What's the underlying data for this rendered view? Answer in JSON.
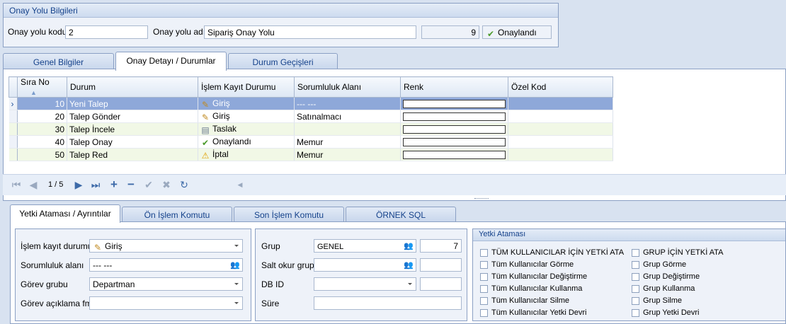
{
  "header": {
    "title": "Onay Yolu Bilgileri",
    "code_label": "Onay yolu kodu",
    "code_value": "2",
    "name_label": "Onay yolu adı",
    "name_value": "Sipariş Onay Yolu",
    "count_value": "9",
    "status_label": "Onaylandı"
  },
  "tabs": [
    "Genel Bilgiler",
    "Onay Detayı / Durumlar",
    "Durum Geçişleri"
  ],
  "grid": {
    "columns": [
      "Sıra No",
      "Durum",
      "İşlem Kayıt Durumu",
      "Sorumluluk Alanı",
      "Renk",
      "Özel Kod"
    ],
    "rows": [
      {
        "no": "10",
        "durum": "Yeni Talep",
        "islem": "Giriş",
        "islem_icon": "edit-icon",
        "sorumluluk": "--- ---"
      },
      {
        "no": "20",
        "durum": "Talep Gönder",
        "islem": "Giriş",
        "islem_icon": "edit-icon",
        "sorumluluk": "Satınalmacı"
      },
      {
        "no": "30",
        "durum": "Talep İncele",
        "islem": "Taslak",
        "islem_icon": "document-icon",
        "sorumluluk": ""
      },
      {
        "no": "40",
        "durum": "Talep Onay",
        "islem": "Onaylandı",
        "islem_icon": "check-icon",
        "sorumluluk": "Memur"
      },
      {
        "no": "50",
        "durum": "Talep Red",
        "islem": "İptal",
        "islem_icon": "warning-icon",
        "sorumluluk": "Memur"
      }
    ]
  },
  "navigator": {
    "position": "1 / 5"
  },
  "subtabs": [
    "Yetki Ataması / Ayrıntılar",
    "Ön İşlem Komutu",
    "Son İşlem Komutu",
    "ÖRNEK SQL"
  ],
  "details": {
    "islem_kayit_label": "İşlem kayıt durumu",
    "islem_kayit_value": "Giriş",
    "sorumluluk_label": "Sorumluluk alanı",
    "sorumluluk_value": "--- ---",
    "gorev_label": "Görev grubu",
    "gorev_value": "Departman",
    "gorev_fmt_label": "Görev açıklama fmt",
    "gorev_fmt_value": "",
    "grup_label": "Grup",
    "grup_value": "GENEL",
    "grup_num": "7",
    "salt_label": "Salt okur grup",
    "dbid_label": "DB ID",
    "sure_label": "Süre"
  },
  "yetki": {
    "title": "Yetki Ataması",
    "left": [
      "TÜM KULLANICILAR İÇİN YETKİ ATA",
      "Tüm Kullanıcılar Görme",
      "Tüm Kullanıcılar Değiştirme",
      "Tüm Kullanıcılar Kullanma",
      "Tüm Kullanıcılar Silme",
      "Tüm Kullanıcılar Yetki Devri"
    ],
    "right": [
      "GRUP İÇİN YETKİ ATA",
      "Grup Görme",
      "Grup Değiştirme",
      "Grup Kullanma",
      "Grup Silme",
      "Grup Yetki Devri"
    ]
  }
}
